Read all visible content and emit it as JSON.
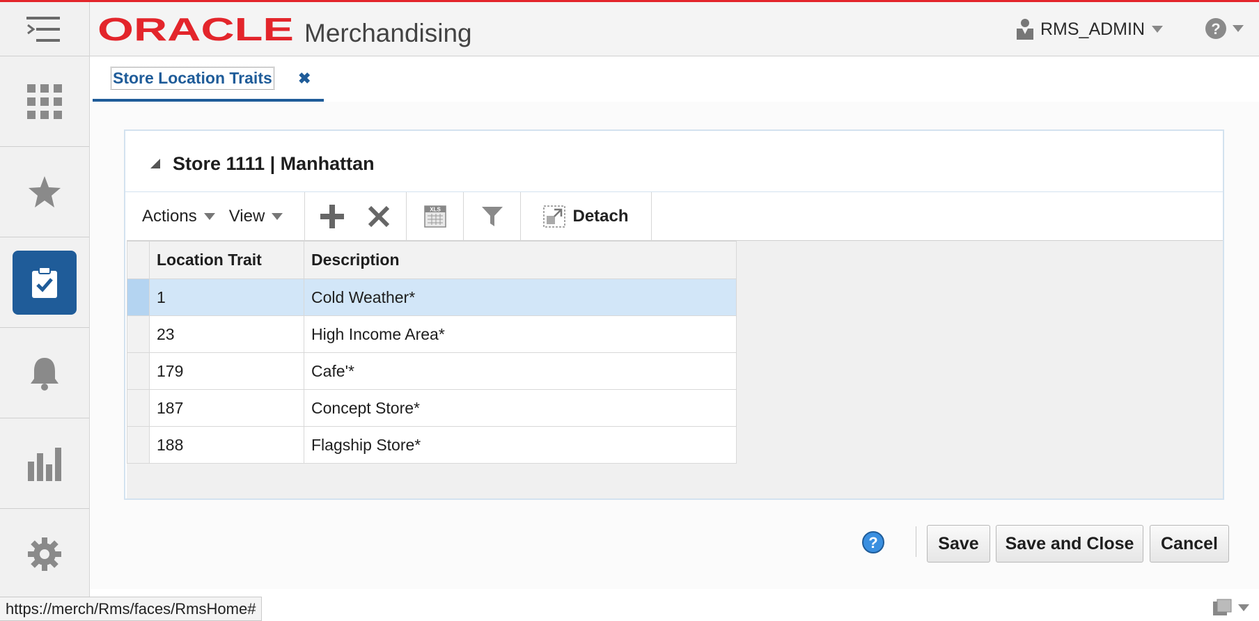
{
  "header": {
    "brand": "ORACLE",
    "app_title": "Merchandising",
    "user": "RMS_ADMIN"
  },
  "rail": {
    "items": [
      "menu-icon",
      "tasks-grid-icon",
      "favorites-star-icon",
      "tasks-clipboard-icon",
      "notifications-bell-icon",
      "reports-chart-icon",
      "settings-gear-icon"
    ],
    "active_index": 3
  },
  "tab": {
    "label": "Store Location Traits"
  },
  "panel": {
    "title": "Store 1111 | Manhattan"
  },
  "toolbar": {
    "actions_label": "Actions",
    "view_label": "View",
    "detach_label": "Detach"
  },
  "table": {
    "columns": [
      "Location Trait",
      "Description"
    ],
    "rows": [
      {
        "trait": "1",
        "description": "Cold Weather*"
      },
      {
        "trait": "23",
        "description": "High Income Area*"
      },
      {
        "trait": "179",
        "description": "Cafe'*"
      },
      {
        "trait": "187",
        "description": "Concept Store*"
      },
      {
        "trait": "188",
        "description": "Flagship Store*"
      }
    ],
    "selected_row": 0
  },
  "footer": {
    "save_label": "Save",
    "save_close_label": "Save and Close",
    "cancel_label": "Cancel"
  },
  "status": {
    "url": "https://merch/Rms/faces/RmsHome#"
  },
  "colors": {
    "accent": "#1f5c99",
    "oracle_red": "#e3252b",
    "selected_row": "#d2e6f8"
  }
}
